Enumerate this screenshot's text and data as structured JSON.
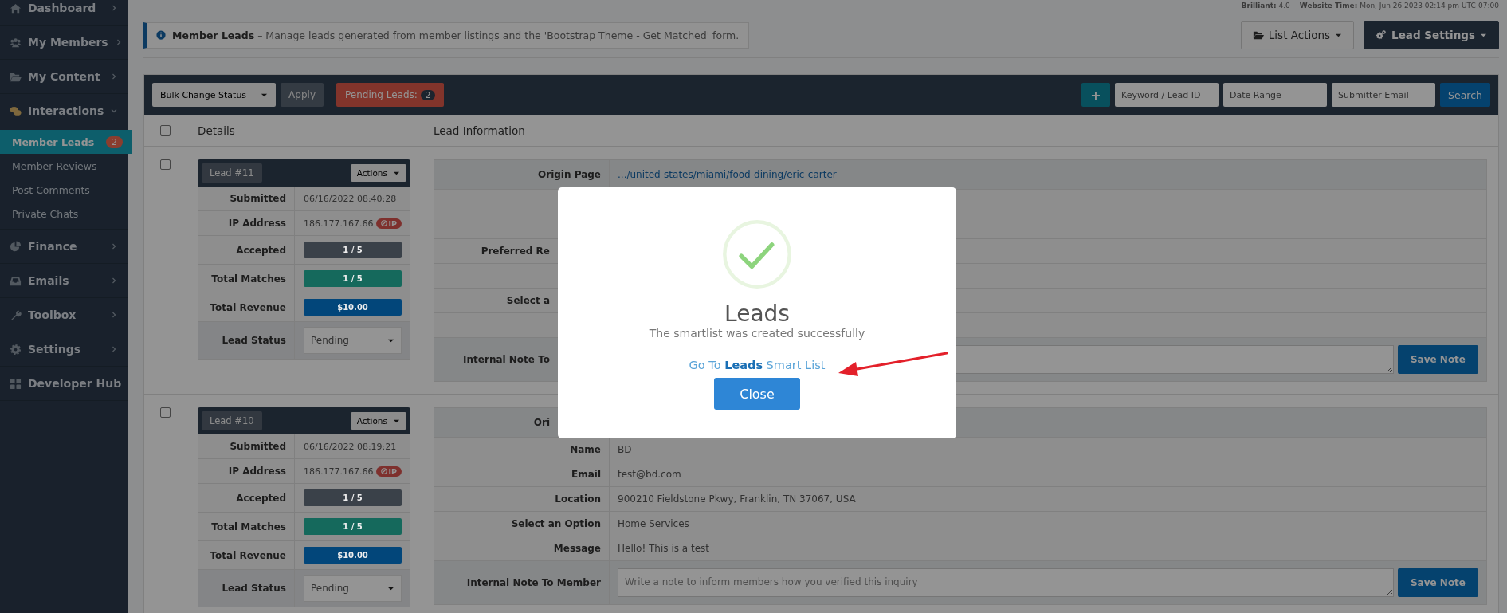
{
  "topbar": {
    "version_label": "Brilliant:",
    "version": "4.0",
    "time_label": "Website Time:",
    "time": "Mon, Jun 26 2023 02:14 pm UTC-07:00"
  },
  "sidebar": {
    "items": [
      {
        "label": "Dashboard",
        "expanded": false
      },
      {
        "label": "My Members",
        "expanded": false
      },
      {
        "label": "My Content",
        "expanded": false
      },
      {
        "label": "Interactions",
        "expanded": true,
        "children": [
          {
            "label": "Member Leads",
            "selected": true,
            "badge": "2"
          },
          {
            "label": "Member Reviews",
            "selected": false
          },
          {
            "label": "Post Comments",
            "selected": false
          },
          {
            "label": "Private Chats",
            "selected": false
          }
        ]
      },
      {
        "label": "Finance",
        "expanded": false
      },
      {
        "label": "Emails",
        "expanded": false
      },
      {
        "label": "Toolbox",
        "expanded": false
      },
      {
        "label": "Settings",
        "expanded": false
      },
      {
        "label": "Developer Hub"
      }
    ]
  },
  "notice": {
    "title": "Member Leads",
    "text": "– Manage leads generated from member listings and the 'Bootstrap Theme - Get Matched' form."
  },
  "header_buttons": [
    {
      "label": "List Actions",
      "kind": "light"
    },
    {
      "label": "Lead Settings",
      "kind": "dark"
    }
  ],
  "toolbar": {
    "bulk_status": "Bulk Change Status",
    "apply": "Apply",
    "pending": {
      "label": "Pending Leads:",
      "count": "2"
    },
    "add": "+",
    "filters": [
      {
        "placeholder": "Keyword / Lead ID"
      },
      {
        "placeholder": "Date Range"
      },
      {
        "placeholder": "Submitter Email"
      }
    ],
    "search": "Search"
  },
  "table": {
    "select_all": {
      "checked": false
    },
    "columns": [
      "Details",
      "Lead Information"
    ],
    "rows": [
      {
        "checked": false,
        "lead": "Lead #11",
        "actions": "Actions",
        "details": [
          {
            "kind": "text",
            "label": "Submitted",
            "value": "06/16/2022 08:40:28"
          },
          {
            "kind": "ip",
            "label": "IP Address",
            "value": "186.177.167.66",
            "badge": "IP"
          },
          {
            "kind": "pill",
            "label": "Accepted",
            "value": "1 / 5",
            "color": "#3a4149"
          },
          {
            "kind": "pill",
            "label": "Total Matches",
            "value": "1 / 5",
            "color": "#15695c"
          },
          {
            "kind": "pill",
            "label": "Total Revenue",
            "value": "$10.00",
            "color": "#02467a"
          },
          {
            "kind": "select",
            "label": "Lead Status",
            "value": "Pending"
          }
        ],
        "info": [
          {
            "kind": "link",
            "label": "Origin Page",
            "value": ".../united-states/miami/food-dining/eric-carter"
          },
          {
            "kind": "field"
          },
          {
            "kind": "field"
          },
          {
            "kind": "field",
            "label": "Preferred Re"
          },
          {
            "kind": "field"
          },
          {
            "kind": "field",
            "label": "Select a"
          },
          {
            "kind": "field"
          },
          {
            "kind": "note",
            "label": "Internal Note To",
            "button": "Save Note"
          }
        ]
      },
      {
        "checked": false,
        "lead": "Lead #10",
        "actions": "Actions",
        "details": [
          {
            "kind": "text",
            "label": "Submitted",
            "value": "06/16/2022 08:19:21"
          },
          {
            "kind": "ip",
            "label": "IP Address",
            "value": "186.177.167.66",
            "badge": "IP"
          },
          {
            "kind": "pill",
            "label": "Accepted",
            "value": "1 / 5",
            "color": "#3a4149"
          },
          {
            "kind": "pill",
            "label": "Total Matches",
            "value": "1 / 5",
            "color": "#15695c"
          },
          {
            "kind": "pill",
            "label": "Total Revenue",
            "value": "$10.00",
            "color": "#02467a"
          },
          {
            "kind": "select",
            "label": "Lead Status",
            "value": "Pending"
          }
        ],
        "info": [
          {
            "kind": "field",
            "label": "Ori"
          },
          {
            "kind": "field",
            "label": "Name",
            "value": "BD"
          },
          {
            "kind": "field",
            "label": "Email",
            "value": "test@bd.com"
          },
          {
            "kind": "field",
            "label": "Location",
            "value": "900210 Fieldstone Pkwy, Franklin, TN 37067, USA"
          },
          {
            "kind": "field",
            "label": "Select an Option",
            "value": "Home Services"
          },
          {
            "kind": "field",
            "label": "Message",
            "value": "Hello! This is a test"
          },
          {
            "kind": "note",
            "label": "Internal Note To Member",
            "placeholder": "Write a note to inform members how you verified this inquiry",
            "button": "Save Note"
          }
        ]
      }
    ]
  },
  "modal": {
    "title": "Leads",
    "message": "The smartlist was created successfully",
    "link": "Go To **Leads** Smart List",
    "button": "Close"
  }
}
